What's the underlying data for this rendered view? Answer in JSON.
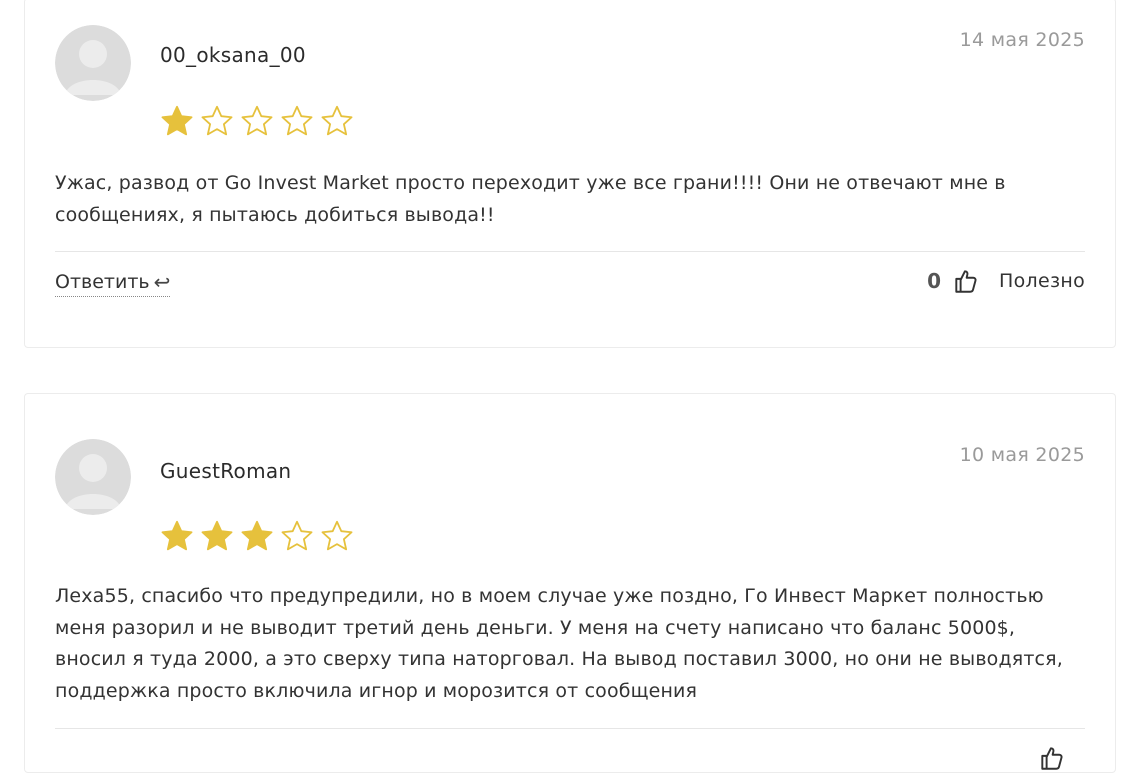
{
  "colors": {
    "star_filled": "#e6c13c",
    "star_empty": "#e6c13c",
    "date": "#9a9a9a"
  },
  "reviews": [
    {
      "author": "00_oksana_00",
      "date": "14 мая 2025",
      "rating": 1,
      "max_rating": 5,
      "text": "Ужас, развод от Go Invest Market просто переходит уже все грани!!!! Они не отвечают мне в сообщениях, я пытаюсь добиться вывода!!",
      "reply_label": "Ответить",
      "reply_icon": "↩",
      "useful_count": "0",
      "useful_label": "Полезно"
    },
    {
      "author": "GuestRoman",
      "date": "10 мая 2025",
      "rating": 3,
      "max_rating": 5,
      "text": "Леха55, спасибо что предупредили, но в моем случае уже поздно, Го Инвест Маркет полностью меня разорил и не выводит третий день деньги. У меня на счету написано что баланс 5000$, вносил я туда 2000, а это сверху типа наторговал. На вывод поставил 3000, но они не выводятся, поддержка просто включила игнор и морозится от сообщения"
    }
  ]
}
